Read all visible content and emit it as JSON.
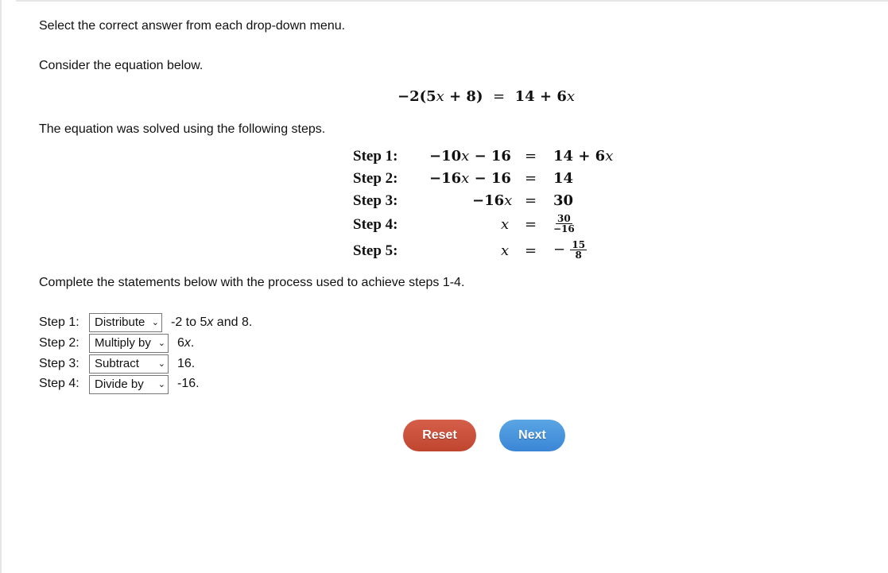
{
  "instructions": "Select the correct answer from each drop-down menu.",
  "consider": "Consider the equation below.",
  "equation": {
    "lhs": "−2(5",
    "lhs_var": "x",
    "lhs_end": " + 8)",
    "eq": "=",
    "rhs": "14 + 6",
    "rhs_var": "x"
  },
  "solved_text": "The equation was solved using the following steps.",
  "steps": [
    {
      "label": "Step 1:",
      "lhs": "−10",
      "lhs_var": "x",
      "lhs_tail": " − 16",
      "rhs": "14 + 6",
      "rhs_var": "x"
    },
    {
      "label": "Step 2:",
      "lhs": "−16",
      "lhs_var": "x",
      "lhs_tail": " − 16",
      "rhs": "14",
      "rhs_var": ""
    },
    {
      "label": "Step 3:",
      "lhs": "−16",
      "lhs_var": "x",
      "lhs_tail": "",
      "rhs": "30",
      "rhs_var": ""
    },
    {
      "label": "Step 4:",
      "lhs": "",
      "lhs_var": "x",
      "lhs_tail": "",
      "rhs_num": "30",
      "rhs_den": "−16"
    },
    {
      "label": "Step 5:",
      "lhs": "",
      "lhs_var": "x",
      "lhs_tail": "",
      "rhs_sign": "−",
      "rhs_num": "15",
      "rhs_den": "8"
    }
  ],
  "eq_sign": "=",
  "complete_text": "Complete the statements below with the process used to achieve steps 1-4.",
  "statements": [
    {
      "label": "Step 1:",
      "selected": "Distribute",
      "after": "-2 to 5",
      "after_var": "x",
      "after_end": " and 8."
    },
    {
      "label": "Step 2:",
      "selected": "Multiply by",
      "after": "6",
      "after_var": "x",
      "after_end": "."
    },
    {
      "label": "Step 3:",
      "selected": "Subtract",
      "after": "16.",
      "after_var": "",
      "after_end": ""
    },
    {
      "label": "Step 4:",
      "selected": "Divide by",
      "after": "-16.",
      "after_var": "",
      "after_end": ""
    }
  ],
  "dropdown_arrow": "⌄",
  "buttons": {
    "reset": "Reset",
    "next": "Next"
  },
  "colors": {
    "reset": "#c9503b",
    "next": "#4a96dd"
  }
}
